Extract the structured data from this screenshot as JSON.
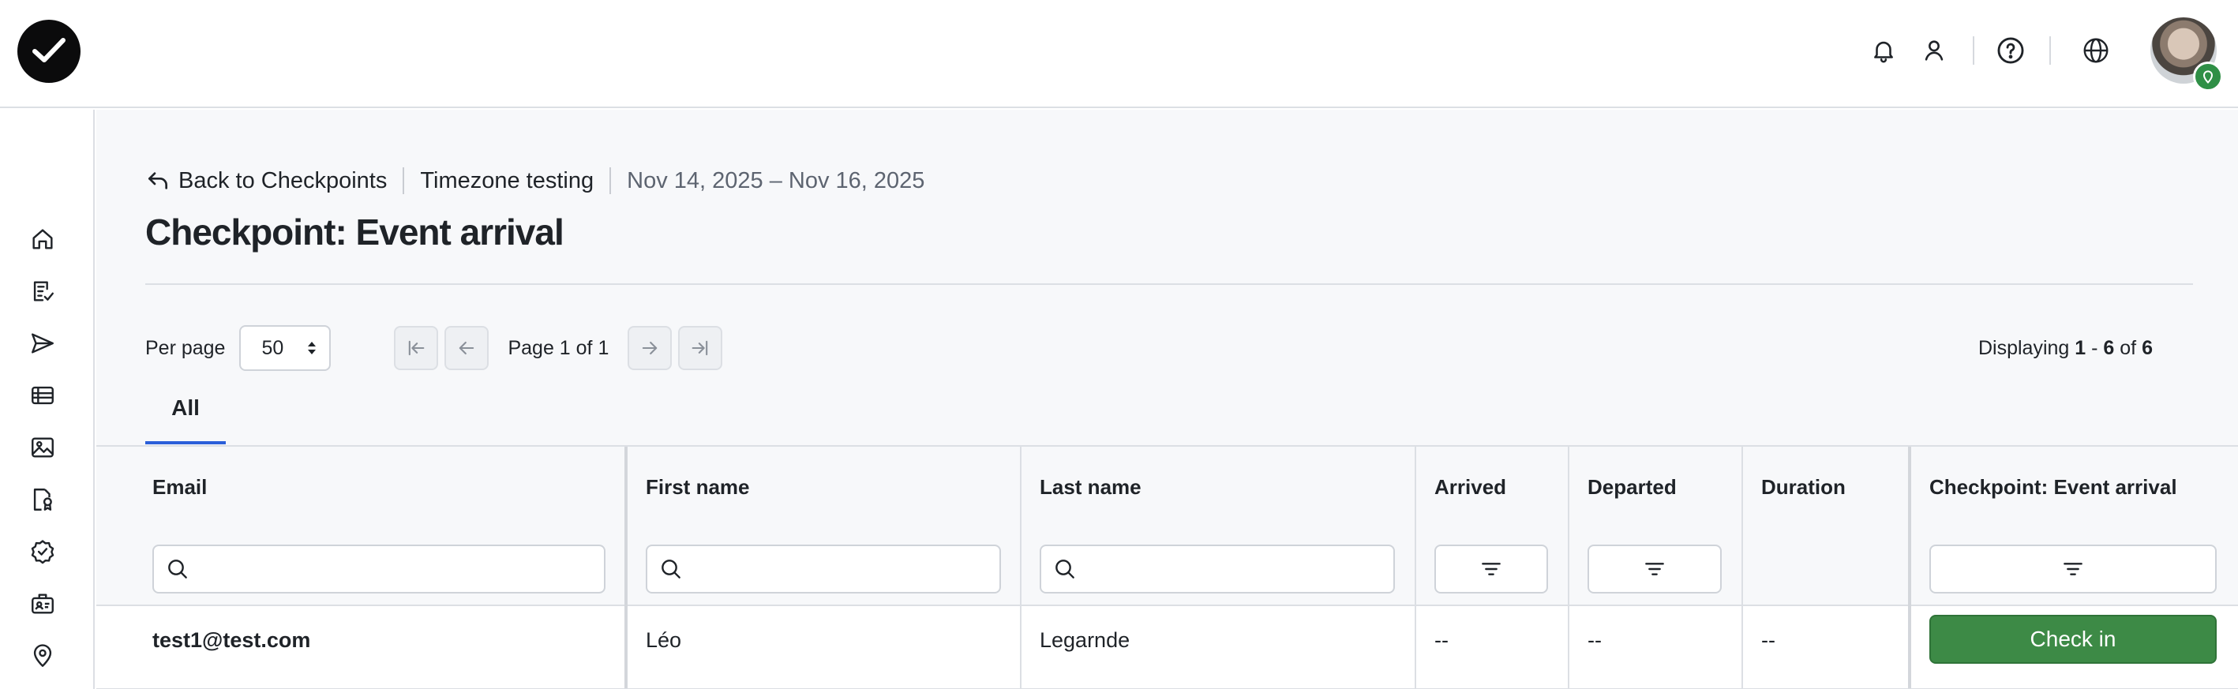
{
  "topbar": {
    "icons": [
      "bell-icon",
      "user-icon",
      "help-icon",
      "globe-icon"
    ],
    "avatar_badge_icon": "pin-badge-icon"
  },
  "sidebar": {
    "icons": [
      "home-icon",
      "checklist-icon",
      "send-icon",
      "list-icon",
      "image-icon",
      "badge-document-icon",
      "verified-icon",
      "id-badge-icon",
      "location-pin-icon"
    ]
  },
  "breadcrumb": {
    "back_label": "Back to Checkpoints",
    "event_name": "Timezone testing",
    "dates": "Nov 14, 2025 – Nov 16, 2025"
  },
  "page_title": "Checkpoint: Event arrival",
  "pagination": {
    "per_page_label": "Per page",
    "per_page_value": "50",
    "page_info": "Page 1 of 1",
    "displaying_prefix": "Displaying",
    "range_start": "1",
    "range_sep": "-",
    "range_end": "6",
    "of_label": "of",
    "total": "6"
  },
  "tabs": [
    {
      "label": "All",
      "active": true
    }
  ],
  "table": {
    "columns": [
      "Email",
      "First name",
      "Last name",
      "Arrived",
      "Departed",
      "Duration",
      "Checkpoint: Event arrival"
    ],
    "rows": [
      {
        "email": "test1@test.com",
        "first_name": "Léo",
        "last_name": "Legarnde",
        "arrived": "--",
        "departed": "--",
        "duration": "--",
        "action": "Check in"
      }
    ]
  },
  "colors": {
    "accent": "#2b5fd9",
    "checkin_button": "#3d8a46",
    "background": "#f7f8fa"
  }
}
